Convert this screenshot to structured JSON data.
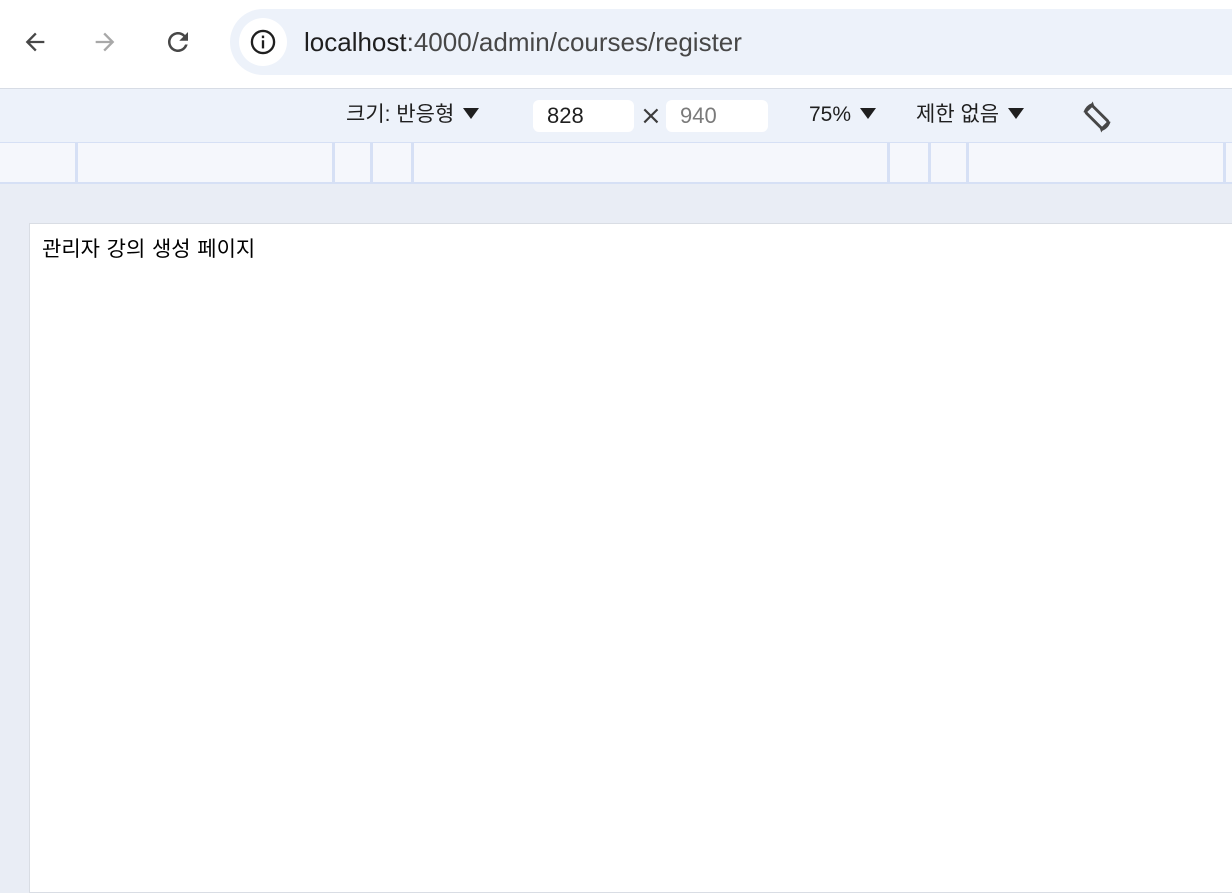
{
  "browser": {
    "url_host": "localhost",
    "url_path": ":4000/admin/courses/register",
    "icons": {
      "back": "arrow-left-icon",
      "forward": "arrow-right-icon",
      "reload": "reload-icon",
      "site_info": "info-icon"
    }
  },
  "device_toolbar": {
    "size_label": "크기: 반응형",
    "width_value": "828",
    "height_placeholder": "940",
    "times_symbol": "×",
    "zoom_label": "75%",
    "throttle_label": "제한 없음",
    "rotate_icon": "rotate-icon"
  },
  "page": {
    "heading": "관리자 강의 생성 페이지"
  },
  "colors": {
    "toolbar_bg": "#ffffff",
    "omnibox_bg": "#edf2fa",
    "device_bar_bg": "#edf2fa",
    "ruler_bg": "#f5f7fc",
    "ruler_mark": "#d6e0f5",
    "canvas_bg": "#e9edf5",
    "viewport_bg": "#ffffff"
  }
}
